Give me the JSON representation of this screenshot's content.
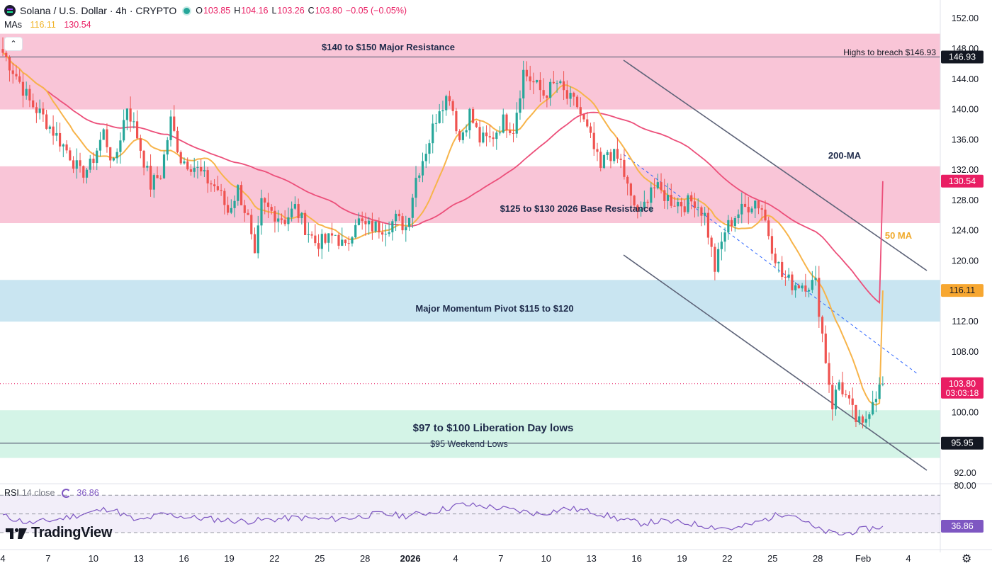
{
  "header": {
    "symbol": "Solana / U.S. Dollar · 4h · CRYPTO",
    "open_label": "O",
    "open": "103.85",
    "high_label": "H",
    "high": "104.16",
    "low_label": "L",
    "low": "103.26",
    "close_label": "C",
    "close": "103.80",
    "change": "−0.05 (−0.05%)"
  },
  "mas": {
    "label": "MAs",
    "ma50": "116.11",
    "ma200": "130.54"
  },
  "rsi": {
    "label": "RSI",
    "params": "14 close",
    "value": "36.86"
  },
  "branding": {
    "name": "TradingView"
  },
  "chart_data": {
    "type": "candlestick",
    "title": "Solana / U.S. Dollar",
    "timeframe": "4h",
    "ylim": [
      90,
      153
    ],
    "y_ticks": [
      "152.00",
      "148.00",
      "144.00",
      "140.00",
      "136.00",
      "132.00",
      "128.00",
      "124.00",
      "120.00",
      "116.00",
      "112.00",
      "108.00",
      "104.00",
      "100.00",
      "96.00",
      "92.00"
    ],
    "x_ticks": [
      "4",
      "7",
      "10",
      "13",
      "16",
      "19",
      "22",
      "25",
      "28",
      "2026",
      "4",
      "7",
      "10",
      "13",
      "16",
      "19",
      "22",
      "25",
      "28",
      "Feb",
      "4"
    ],
    "zones": [
      {
        "low": 140,
        "high": 150,
        "label": "$140 to $150 Major Resistance",
        "color": "#f8bbd0"
      },
      {
        "low": 125,
        "high": 132.5,
        "label": "$125 to $130 2026 Base Resistance",
        "color": "#f8bbd0"
      },
      {
        "low": 112,
        "high": 117.5,
        "label": "Major Momentum Pivot $115 to $120",
        "color": "#bfe0ee"
      },
      {
        "low": 94,
        "high": 100.3,
        "label": "$97 to $100 Liberation Day lows",
        "color": "#ccf2e3"
      }
    ],
    "levels": [
      {
        "value": 146.93,
        "label": "Highs to breach $146.93"
      },
      {
        "value": 95.95,
        "label": "$95 Weekend Lows"
      }
    ],
    "price_labels": [
      {
        "value": 146.93,
        "text": "146.93",
        "bg": "#131722",
        "fg": "#ffffff"
      },
      {
        "value": 130.54,
        "text": "130.54",
        "bg": "#e91e63",
        "fg": "#ffffff"
      },
      {
        "value": 116.11,
        "text": "116.11",
        "bg": "#f7a731",
        "fg": "#131722"
      },
      {
        "value": 103.8,
        "text": "103.80",
        "sub": "03:03:18",
        "bg": "#e91e63",
        "fg": "#ffffff"
      },
      {
        "value": 95.95,
        "text": "95.95",
        "bg": "#131722",
        "fg": "#ffffff"
      }
    ],
    "annotations": [
      {
        "text": "200-MA",
        "color": "#1e2a4a"
      },
      {
        "text": "50 MA",
        "color": "#f0a92a"
      }
    ],
    "close_path": [
      [
        0,
        147.5
      ],
      [
        4,
        144.5
      ],
      [
        8,
        141
      ],
      [
        12,
        139
      ],
      [
        16,
        136.5
      ],
      [
        20,
        134
      ],
      [
        23,
        131.5
      ],
      [
        26,
        132.5
      ],
      [
        30,
        137
      ],
      [
        33,
        132.5
      ],
      [
        37,
        140.5
      ],
      [
        40,
        136.5
      ],
      [
        44,
        130
      ],
      [
        47,
        131.5
      ],
      [
        50,
        138.5
      ],
      [
        53,
        133.5
      ],
      [
        57,
        132.5
      ],
      [
        60,
        131
      ],
      [
        64,
        129.5
      ],
      [
        67,
        126.5
      ],
      [
        70,
        129.5
      ],
      [
        73,
        125.5
      ],
      [
        75,
        120
      ],
      [
        77,
        127.5
      ],
      [
        80,
        126.5
      ],
      [
        84,
        125.5
      ],
      [
        87,
        127
      ],
      [
        90,
        124.5
      ],
      [
        93,
        122.5
      ],
      [
        96,
        122.5
      ],
      [
        99,
        123.5
      ],
      [
        102,
        121.5
      ],
      [
        105,
        125.5
      ],
      [
        108,
        124.5
      ],
      [
        111,
        124.5
      ],
      [
        114,
        124.5
      ],
      [
        117,
        125.5
      ],
      [
        120,
        124.5
      ],
      [
        123,
        131
      ],
      [
        127,
        136
      ],
      [
        130,
        140.5
      ],
      [
        133,
        142
      ],
      [
        136,
        136
      ],
      [
        139,
        139.5
      ],
      [
        142,
        136
      ],
      [
        145,
        136
      ],
      [
        149,
        138.5
      ],
      [
        152,
        137.5
      ],
      [
        155,
        145
      ],
      [
        158,
        143.5
      ],
      [
        161,
        142
      ],
      [
        165,
        143.5
      ],
      [
        168,
        141.5
      ],
      [
        171,
        140.5
      ],
      [
        175,
        136
      ],
      [
        178,
        132
      ],
      [
        180,
        134.5
      ],
      [
        184,
        133
      ],
      [
        187,
        128
      ],
      [
        190,
        126
      ],
      [
        193,
        130
      ],
      [
        196,
        129
      ],
      [
        199,
        128
      ],
      [
        203,
        127.5
      ],
      [
        206,
        128
      ],
      [
        209,
        126
      ],
      [
        212,
        119
      ],
      [
        215,
        124
      ],
      [
        218,
        126
      ],
      [
        221,
        127
      ],
      [
        224,
        128
      ],
      [
        226,
        127
      ],
      [
        229,
        122
      ],
      [
        232,
        118
      ],
      [
        235,
        117
      ],
      [
        239,
        117
      ],
      [
        242,
        117
      ],
      [
        245,
        107
      ],
      [
        247,
        101
      ],
      [
        249,
        104
      ],
      [
        252,
        101
      ],
      [
        254,
        99
      ],
      [
        256,
        98
      ],
      [
        259,
        102
      ],
      [
        262,
        103.8
      ]
    ],
    "rsi_ylim": [
      20,
      82
    ],
    "rsi_levels": [
      70,
      50,
      30
    ],
    "rsi_path": [
      [
        0,
        48
      ],
      [
        8,
        40
      ],
      [
        16,
        44
      ],
      [
        24,
        50
      ],
      [
        32,
        56
      ],
      [
        40,
        42
      ],
      [
        48,
        50
      ],
      [
        56,
        46
      ],
      [
        64,
        44
      ],
      [
        72,
        42
      ],
      [
        80,
        44
      ],
      [
        88,
        46
      ],
      [
        96,
        44
      ],
      [
        104,
        46
      ],
      [
        112,
        50
      ],
      [
        120,
        48
      ],
      [
        128,
        52
      ],
      [
        136,
        60
      ],
      [
        144,
        58
      ],
      [
        152,
        54
      ],
      [
        160,
        50
      ],
      [
        168,
        56
      ],
      [
        176,
        52
      ],
      [
        184,
        44
      ],
      [
        190,
        40
      ],
      [
        196,
        42
      ],
      [
        204,
        40
      ],
      [
        212,
        36
      ],
      [
        218,
        34
      ],
      [
        224,
        40
      ],
      [
        230,
        48
      ],
      [
        234,
        52
      ],
      [
        238,
        44
      ],
      [
        242,
        34
      ],
      [
        246,
        30
      ],
      [
        250,
        28
      ],
      [
        254,
        32
      ],
      [
        258,
        34
      ],
      [
        262,
        36.86
      ]
    ]
  }
}
